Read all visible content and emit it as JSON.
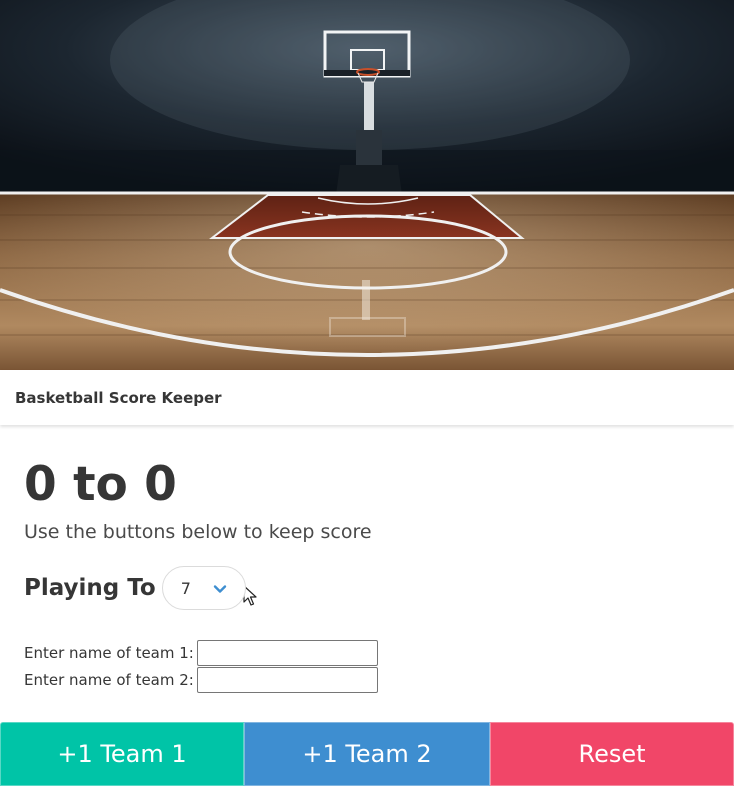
{
  "card": {
    "title": "Basketball Score Keeper"
  },
  "score": {
    "display": "0 to 0",
    "subtitle": "Use the buttons below to keep score"
  },
  "playing_to": {
    "label": "Playing To",
    "selected": "7"
  },
  "teams": {
    "team1_label": "Enter name of team 1:",
    "team2_label": "Enter name of team 2:",
    "team1_value": "",
    "team2_value": ""
  },
  "buttons": {
    "team1": "+1 Team 1",
    "team2": "+1 Team 2",
    "reset": "Reset"
  },
  "colors": {
    "team1": "#00c4a7",
    "team2": "#3e8ed0",
    "reset": "#f14668",
    "chevron": "#3e8ed0"
  },
  "icons": {
    "select_chevron": "chevron-down-icon",
    "mouse_cursor": "cursor-icon"
  }
}
